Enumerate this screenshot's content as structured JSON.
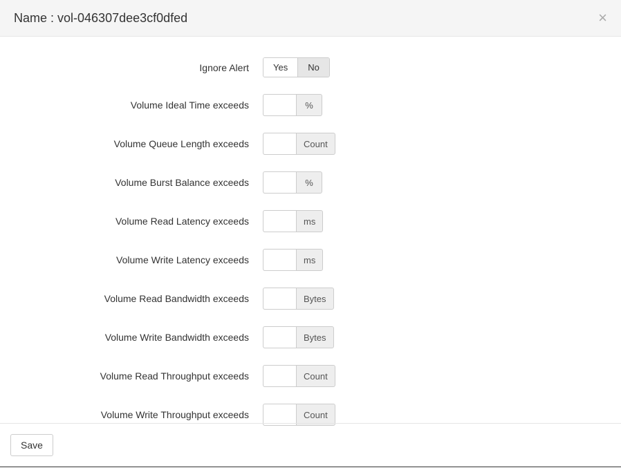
{
  "header": {
    "title": "Name : vol-046307dee3cf0dfed"
  },
  "fields": {
    "ignore_alert": {
      "label": "Ignore Alert",
      "options": {
        "yes": "Yes",
        "no": "No"
      },
      "value": "No"
    },
    "ideal_time": {
      "label": "Volume Ideal Time exceeds",
      "value": "",
      "unit": "%"
    },
    "queue_length": {
      "label": "Volume Queue Length exceeds",
      "value": "",
      "unit": "Count"
    },
    "burst_balance": {
      "label": "Volume Burst Balance exceeds",
      "value": "",
      "unit": "%"
    },
    "read_latency": {
      "label": "Volume Read Latency exceeds",
      "value": "",
      "unit": "ms"
    },
    "write_latency": {
      "label": "Volume Write Latency exceeds",
      "value": "",
      "unit": "ms"
    },
    "read_bandwidth": {
      "label": "Volume Read Bandwidth exceeds",
      "value": "",
      "unit": "Bytes"
    },
    "write_bandwidth": {
      "label": "Volume Write Bandwidth exceeds",
      "value": "",
      "unit": "Bytes"
    },
    "read_throughput": {
      "label": "Volume Read Throughput exceeds",
      "value": "",
      "unit": "Count"
    },
    "write_throughput": {
      "label": "Volume Write Throughput exceeds",
      "value": "",
      "unit": "Count"
    }
  },
  "footer": {
    "save_label": "Save"
  }
}
